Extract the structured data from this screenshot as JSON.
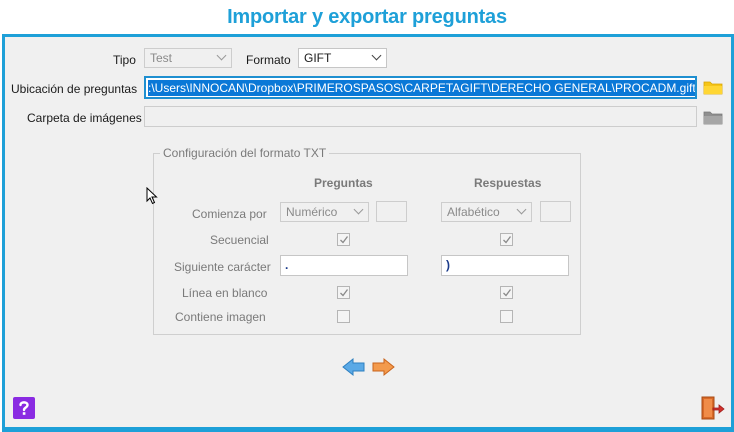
{
  "window": {
    "title": "Importar y exportar preguntas"
  },
  "form": {
    "tipo_label": "Tipo",
    "tipo_value": "Test",
    "formato_label": "Formato",
    "formato_value": "GIFT",
    "ubicacion_label": "Ubicación de preguntas",
    "ubicacion_value": ":\\Users\\INNOCAN\\Dropbox\\PRIMEROSPASOS\\CARPETAGIFT\\DERECHO GENERAL\\PROCADM.gift",
    "carpeta_label": "Carpeta de imágenes",
    "carpeta_value": ""
  },
  "txt_config": {
    "title": "Configuración del formato TXT",
    "col_preguntas": "Preguntas",
    "col_respuestas": "Respuestas",
    "rows": {
      "comienza_label": "Comienza por",
      "comienza_preguntas": "Numérico",
      "comienza_respuestas": "Alfabético",
      "secuencial_label": "Secuencial",
      "secuencial_preguntas": true,
      "secuencial_respuestas": true,
      "siguiente_label": "Siguiente carácter",
      "siguiente_preguntas": ".",
      "siguiente_respuestas": ")",
      "linea_label": "Línea en blanco",
      "linea_preguntas": true,
      "linea_respuestas": true,
      "imagen_label": "Contiene imagen",
      "imagen_preguntas": false,
      "imagen_respuestas": false
    }
  },
  "colors": {
    "accent": "#1ea0d8",
    "folder_active": "#f5c518",
    "folder_disabled": "#9a9a9a",
    "help_button": "#8a2be2",
    "exit_button": "#e06020"
  },
  "icons": {
    "browse_path": "folder-icon",
    "browse_images": "folder-icon",
    "prev": "arrow-left-icon",
    "next": "arrow-right-icon",
    "help": "question-icon",
    "exit": "exit-door-icon"
  }
}
